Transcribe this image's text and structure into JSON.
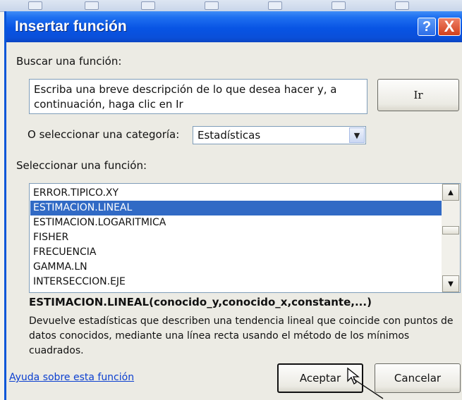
{
  "dialog": {
    "title": "Insertar función",
    "help_button": "?",
    "close_button": "X"
  },
  "search": {
    "label": "Buscar una función:",
    "value": "Escriba una breve descripción de lo que desea hacer y, a continuación, haga clic en Ir",
    "go_label": "Ir"
  },
  "category": {
    "label": "O seleccionar una categoría:",
    "selected": "Estadísticas"
  },
  "functions": {
    "label": "Seleccionar una función:",
    "items": [
      {
        "label": "ERROR.TIPICO.XY",
        "selected": false
      },
      {
        "label": "ESTIMACION.LINEAL",
        "selected": true
      },
      {
        "label": "ESTIMACION.LOGARITMICA",
        "selected": false
      },
      {
        "label": "FISHER",
        "selected": false
      },
      {
        "label": "FRECUENCIA",
        "selected": false
      },
      {
        "label": "GAMMA.LN",
        "selected": false
      },
      {
        "label": "INTERSECCION.EJE",
        "selected": false
      }
    ]
  },
  "selected_function": {
    "signature": "ESTIMACION.LINEAL(conocido_y,conocido_x,constante,...)",
    "description": "Devuelve estadísticas que describen una tendencia lineal que coincide con puntos de datos conocidos, mediante una línea recta usando el método de los mínimos cuadrados."
  },
  "footer": {
    "help_link": "Ayuda sobre esta función",
    "ok_label": "Aceptar",
    "cancel_label": "Cancelar"
  },
  "colors": {
    "titlebar": "#0854e4",
    "selection": "#316ac5",
    "link": "#0b3fd0"
  }
}
